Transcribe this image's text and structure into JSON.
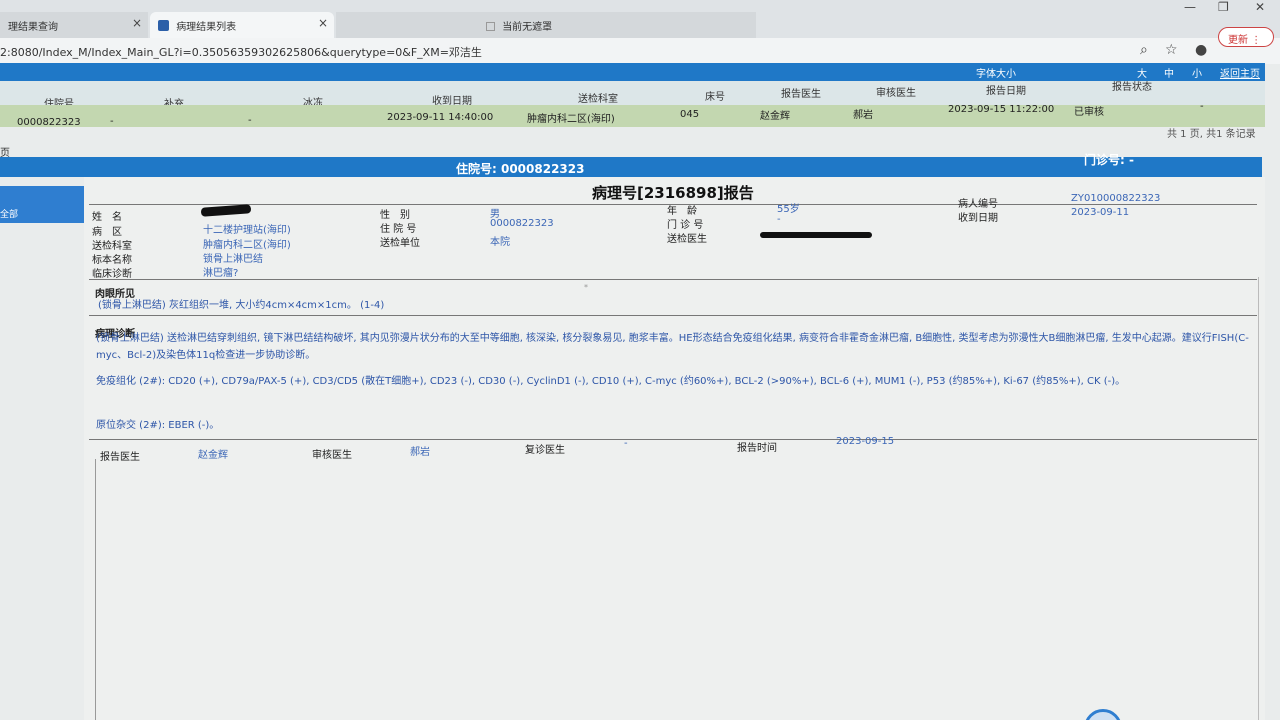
{
  "browser": {
    "tabs": [
      {
        "label": "理结果查询"
      },
      {
        "label": "病理结果列表"
      },
      {
        "label": "当前无遮罩"
      }
    ],
    "url": "2:8080/Index_M/Index_Main_GL?i=0.35056359302625806&querytype=0&F_XM=邓洁生",
    "update_label": "更新"
  },
  "header": {
    "font_size_label": "字体大小",
    "size_large": "大",
    "size_medium": "中",
    "size_small": "小",
    "home_link": "返回主页"
  },
  "results_table": {
    "columns": [
      "住院号",
      "补充",
      "冰冻",
      "收到日期",
      "送检科室",
      "床号",
      "报告医生",
      "审核医生",
      "报告日期",
      "报告状态"
    ],
    "row": {
      "inpatient_no": "0000822323",
      "supplement": "-",
      "frozen": "-",
      "received_date": "2023-09-11 14:40:00",
      "department": "肿瘤内科二区(海印)",
      "bed": "045",
      "report_doctor": "赵金辉",
      "review_doctor": "郝岩",
      "report_date": "2023-09-15 11:22:00",
      "status": "已审核",
      "extra": "-"
    },
    "pager": "共 1 页, 共1 条记录"
  },
  "left_label": "页",
  "hosp_bar": {
    "inpatient": "住院号: 0000822323",
    "outpatient": "门诊号: -"
  },
  "sidebar": {
    "item": "全部"
  },
  "report": {
    "title": "病理号[2316898]报告",
    "fields": {
      "name_label": "姓　名",
      "ward_label": "病　区",
      "ward": "十二楼护理站(海印)",
      "dept_label": "送检科室",
      "dept": "肿瘤内科二区(海印)",
      "specimen_label": "标本名称",
      "specimen": "锁骨上淋巴结",
      "clin_label": "临床诊断",
      "clin": "淋巴瘤?",
      "sex_label": "性　别",
      "sex": "男",
      "inpatient_label": "住 院 号",
      "inpatient": "0000822323",
      "unit_label": "送检单位",
      "unit": "本院",
      "age_label": "年　龄",
      "age": "55岁",
      "outpatient_label": "门 诊 号",
      "outpatient": "-",
      "send_doc_label": "送检医生",
      "patient_id_label": "病人编号",
      "patient_id": "ZY010000822323",
      "received_label": "收到日期",
      "received": "2023-09-11"
    },
    "gross_label": "肉眼所见",
    "gross_text": "(锁骨上淋巴结) 灰红组织一堆, 大小约4cm×4cm×1cm。 (1-4)",
    "diag_label": "病理诊断",
    "diag_text": "(锁骨上淋巴结) 送检淋巴结穿刺组织, 镜下淋巴结结构破坏, 其内见弥漫片状分布的大至中等细胞, 核深染, 核分裂象易见, 胞浆丰富。HE形态结合免疫组化结果, 病变符合非霍奇金淋巴瘤, B细胞性, 类型考虑为弥漫性大B细胞淋巴瘤, 生发中心起源。建议行FISH(C-myc、Bcl-2)及染色体11q检查进一步协助诊断。",
    "ihc_text": "免疫组化 (2#): CD20 (+), CD79a/PAX-5 (+), CD3/CD5 (散在T细胞+), CD23 (-), CD30 (-), CyclinD1 (-), CD10 (+), C-myc (约60%+), BCL-2 (>90%+), BCL-6 (+), MUM1 (-), P53 (约85%+), Ki-67 (约85%+), CK (-)。",
    "ish_text": "原位杂交 (2#): EBER (-)。",
    "footer": {
      "report_doc_label": "报告医生",
      "report_doc": "赵金辉",
      "review_doc_label": "审核医生",
      "review_doc": "郝岩",
      "recheck_label": "复诊医生",
      "recheck": "-",
      "report_time_label": "报告时间",
      "report_time": "2023-09-15"
    }
  }
}
